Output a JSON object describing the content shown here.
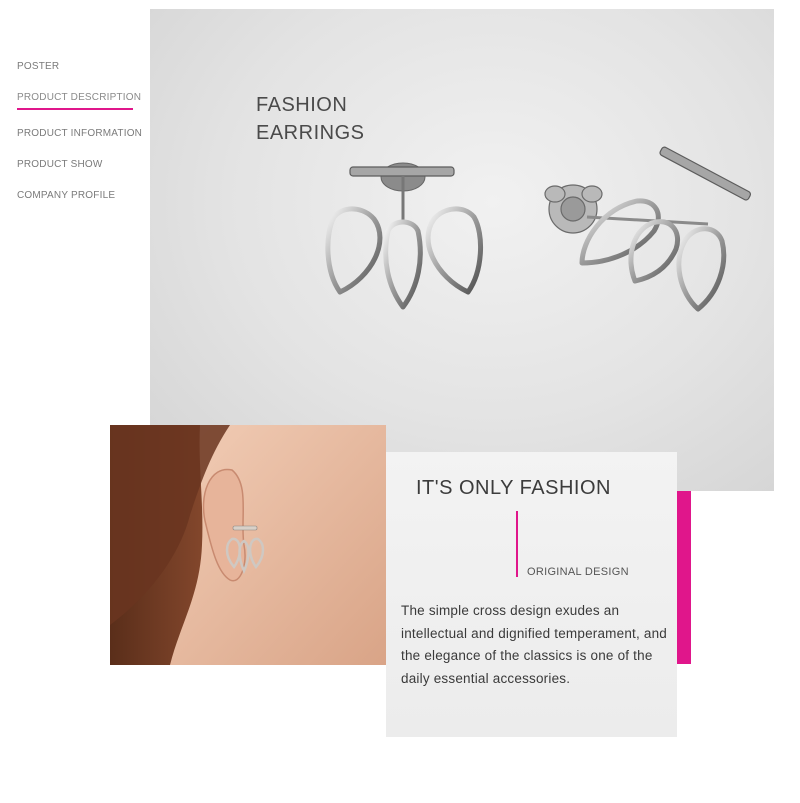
{
  "nav": {
    "items": [
      {
        "label": "POSTER"
      },
      {
        "label": "PRODUCT DESCRIPTION",
        "active": true
      },
      {
        "label": "PRODUCT INFORMATION"
      },
      {
        "label": "PRODUCT SHOW"
      },
      {
        "label": "COMPANY PROFILE"
      }
    ],
    "accent_color": "#e0168b"
  },
  "hero": {
    "title_line1": "FASHION",
    "title_line2": "EARRINGS",
    "image": "silver-lotus-earrings"
  },
  "photo": {
    "image": "model-wearing-earring"
  },
  "card": {
    "title": "IT'S ONLY FASHION",
    "subtitle": "ORIGINAL DESIGN",
    "body": "The simple cross design exudes an intellectual and dignified temperament, and the elegance of the classics is one of the daily essential accessories."
  }
}
